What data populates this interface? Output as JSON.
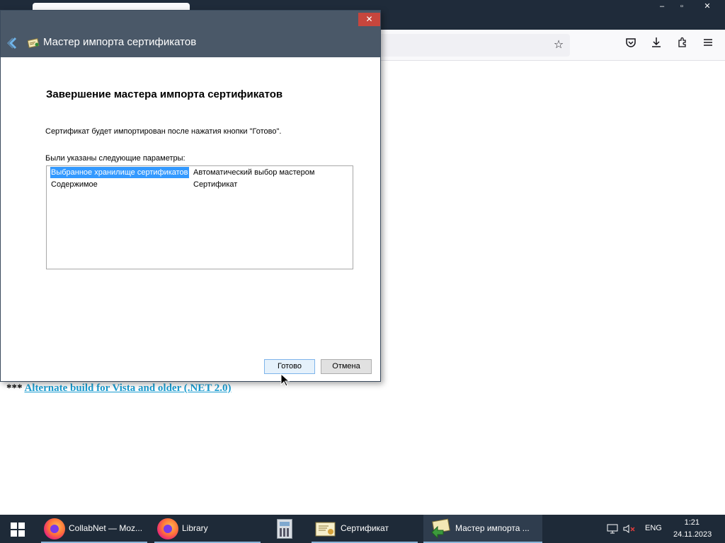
{
  "browser": {
    "window_controls": {
      "minimize": "–",
      "maximize": "▫",
      "close": "✕"
    }
  },
  "page": {
    "prefix": "***",
    "link_text": "Alternate build for Vista and older (.NET 2.0)"
  },
  "wizard": {
    "title": "Мастер импорта сертификатов",
    "close_label": "✕",
    "heading": "Завершение мастера импорта сертификатов",
    "description": "Сертификат будет импортирован после нажатия кнопки \"Готово\".",
    "params_label": "Были указаны следующие параметры:",
    "params": [
      {
        "name": "Выбранное хранилище сертификатов",
        "value": "Автоматический выбор мастером",
        "selected": true
      },
      {
        "name": "Содержимое",
        "value": "Сертификат",
        "selected": false
      }
    ],
    "finish_label": "Готово",
    "cancel_label": "Отмена"
  },
  "taskbar": {
    "items": [
      {
        "label": "CollabNet — Moz...",
        "icon": "firefox-icon"
      },
      {
        "label": "Library",
        "icon": "firefox-icon"
      },
      {
        "label": "",
        "icon": "calculator-icon"
      },
      {
        "label": "Сертификат",
        "icon": "certificate-icon"
      },
      {
        "label": "Мастер импорта ...",
        "icon": "cert-wizard-icon"
      }
    ],
    "tray": {
      "language": "ENG",
      "time": "1:21",
      "date": "24.11.2023"
    }
  },
  "colors": {
    "accent_selection": "#3399ff",
    "link": "#1a9cd0",
    "close_button": "#c7463d",
    "taskbar": "#1e2a38"
  }
}
